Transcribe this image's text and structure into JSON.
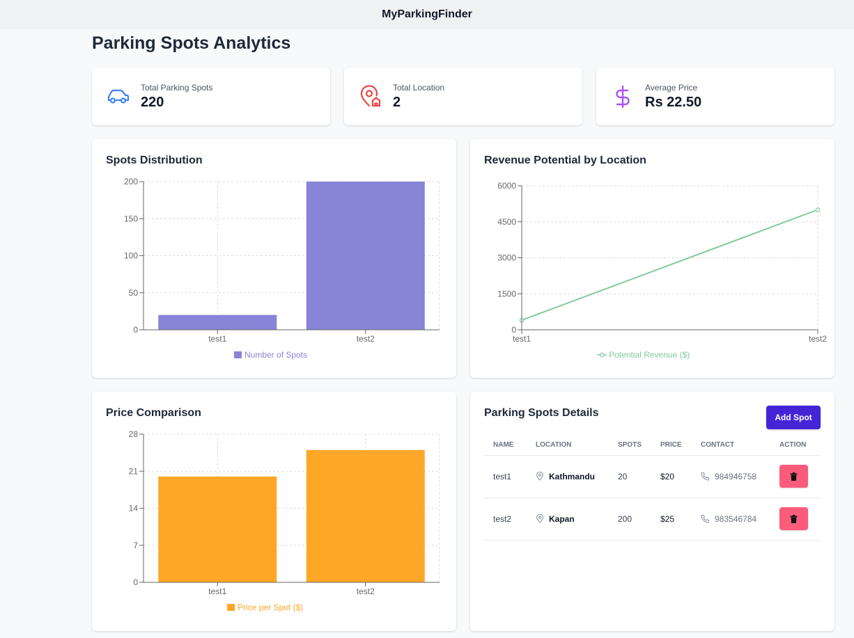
{
  "app": {
    "title": "MyParkingFinder"
  },
  "page": {
    "title": "Parking Spots Analytics"
  },
  "stats": [
    {
      "label": "Total Parking Spots",
      "value": "220",
      "icon": "car-icon",
      "color": "#3b82f6"
    },
    {
      "label": "Total Location",
      "value": "2",
      "icon": "location-home-icon",
      "color": "#ef4444"
    },
    {
      "label": "Average Price",
      "value": "Rs 22.50",
      "icon": "dollar-icon",
      "color": "#a855f7"
    }
  ],
  "panels": {
    "spots": {
      "title": "Spots Distribution"
    },
    "revenue": {
      "title": "Revenue Potential by Location"
    },
    "price": {
      "title": "Price Comparison"
    },
    "details": {
      "title": "Parking Spots Details",
      "add_label": "Add Spot"
    }
  },
  "chart_data": [
    {
      "type": "bar",
      "title": "Spots Distribution",
      "categories": [
        "test1",
        "test2"
      ],
      "series": [
        {
          "name": "Number of Spots",
          "values": [
            20,
            200
          ],
          "color": "#8884d8"
        }
      ],
      "ylim": [
        0,
        200
      ],
      "yticks": [
        "0",
        "50",
        "100",
        "150",
        "200"
      ],
      "grid": true,
      "legend": "bottom"
    },
    {
      "type": "line",
      "title": "Revenue Potential by Location",
      "categories": [
        "test1",
        "test2"
      ],
      "series": [
        {
          "name": "Potential Revenue ($)",
          "values": [
            400,
            5000
          ],
          "color": "#82ca9d"
        }
      ],
      "ylim": [
        0,
        6000
      ],
      "yticks": [
        "0",
        "1500",
        "3000",
        "4500",
        "6000"
      ],
      "grid": true,
      "legend": "bottom"
    },
    {
      "type": "bar",
      "title": "Price Comparison",
      "categories": [
        "test1",
        "test2"
      ],
      "series": [
        {
          "name": "Price per Spot ($)",
          "values": [
            20,
            25
          ],
          "color": "#ffa726"
        }
      ],
      "ylim": [
        0,
        28
      ],
      "yticks": [
        "0",
        "7",
        "14",
        "21",
        "28"
      ],
      "grid": true,
      "legend": "bottom"
    }
  ],
  "table": {
    "headers": [
      "NAME",
      "LOCATION",
      "SPOTS",
      "PRICE",
      "CONTACT",
      "ACTION"
    ],
    "rows": [
      {
        "name": "test1",
        "location": "Kathmandu",
        "spots": "20",
        "price": "$20",
        "contact": "984946758"
      },
      {
        "name": "test2",
        "location": "Kapan",
        "spots": "200",
        "price": "$25",
        "contact": "983546784"
      }
    ]
  }
}
